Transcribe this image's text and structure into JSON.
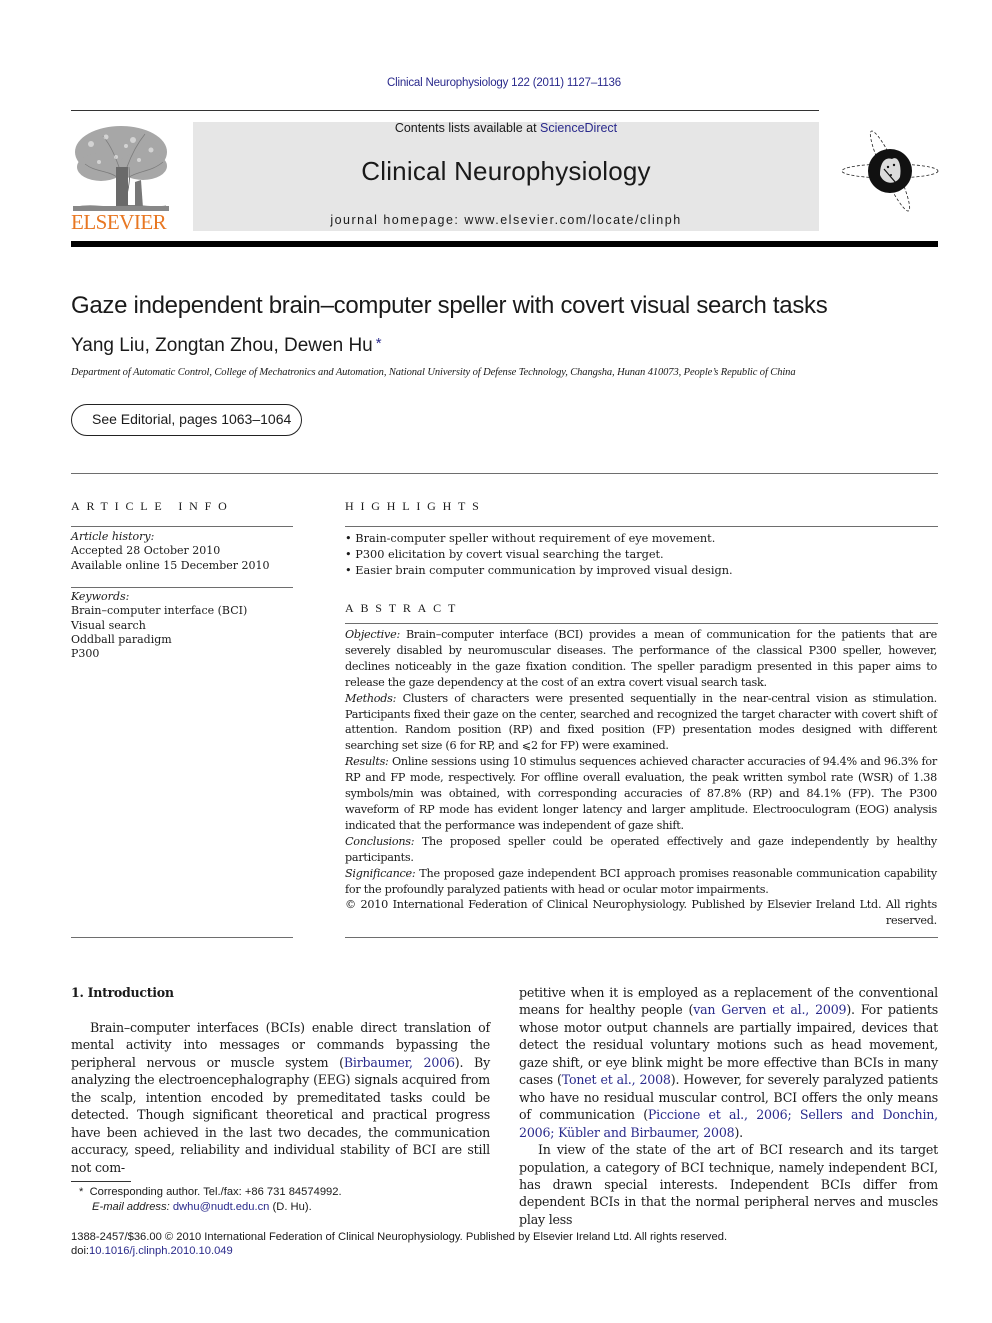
{
  "header": {
    "citation": "Clinical Neurophysiology 122 (2011) 1127–1136",
    "contents_prefix": "Contents lists available at ",
    "contents_link": "ScienceDirect",
    "journal_name": "Clinical Neurophysiology",
    "homepage": "journal homepage: www.elsevier.com/locate/clinph",
    "publisher_logo_text": "ELSEVIER",
    "publisher_logo_icon": "elsevier-tree-icon",
    "society_logo_icon": "society-emblem-icon",
    "colors": {
      "link": "#2a2a8c",
      "elsevier_orange": "#e87722",
      "banner_gray": "#e6e6e6"
    }
  },
  "article": {
    "title": "Gaze independent brain–computer speller with covert visual search tasks",
    "authors": "Yang Liu, Zongtan Zhou, Dewen Hu",
    "corresponding_mark": "*",
    "affiliation": "Department of Automatic Control, College of Mechatronics and Automation, National University of Defense Technology, Changsha, Hunan 410073, People’s Republic of China",
    "editorial_link": "See Editorial, pages 1063–1064"
  },
  "article_info": {
    "heading": "ARTICLE INFO",
    "history_label": "Article history:",
    "history": [
      "Accepted 28 October 2010",
      "Available online 15 December 2010"
    ],
    "keywords_label": "Keywords:",
    "keywords": [
      "Brain–computer interface (BCI)",
      "Visual search",
      "Oddball paradigm",
      "P300"
    ]
  },
  "highlights": {
    "heading": "HIGHLIGHTS",
    "bullet": "•",
    "items": [
      "Brain-computer speller without requirement of eye movement.",
      "P300 elicitation by covert visual searching the target.",
      "Easier brain computer communication by improved visual design."
    ]
  },
  "abstract": {
    "heading": "ABSTRACT",
    "sections": [
      {
        "label": "Objective:",
        "text": " Brain–computer interface (BCI) provides a mean of communication for the patients that are severely disabled by neuromuscular diseases. The performance of the classical P300 speller, however, declines noticeably in the gaze fixation condition. The speller paradigm presented in this paper aims to release the gaze dependency at the cost of an extra covert visual search task."
      },
      {
        "label": "Methods:",
        "text": " Clusters of characters were presented sequentially in the near-central vision as stimulation. Participants fixed their gaze on the center, searched and recognized the target character with covert shift of attention. Random position (RP) and fixed position (FP) presentation modes designed with different searching set size (6 for RP, and ⩽2 for FP) were examined."
      },
      {
        "label": "Results:",
        "text": " Online sessions using 10 stimulus sequences achieved character accuracies of 94.4% and 96.3% for RP and FP mode, respectively. For offline overall evaluation, the peak written symbol rate (WSR) of 1.38 symbols/min was obtained, with corresponding accuracies of 87.8% (RP) and 84.1% (FP). The P300 waveform of RP mode has evident longer latency and larger amplitude. Electrooculogram (EOG) analysis indicated that the performance was independent of gaze shift."
      },
      {
        "label": "Conclusions:",
        "text": " The proposed speller could be operated effectively and gaze independently by healthy participants."
      },
      {
        "label": "Significance:",
        "text": " The proposed gaze independent BCI approach promises reasonable communication capability for the profoundly paralyzed patients with head or ocular motor impairments."
      }
    ],
    "copyright_main": "© 2010 International Federation of Clinical Neurophysiology. Published by Elsevier Ireland Ltd. All rights",
    "copyright_end": "reserved."
  },
  "introduction": {
    "heading": "1. Introduction",
    "left_column": {
      "p1_before": "Brain–computer interfaces (BCIs) enable direct translation of mental activity into messages or commands bypassing the peripheral nervous or muscle system (",
      "p1_link": "Birbaumer, 2006",
      "p1_after": "). By analyzing the electroencephalography (EEG) signals acquired from the scalp, intention encoded by premeditated tasks could be detected. Though significant theoretical and practical progress have been achieved in the last two decades, the communication accuracy, speed, reliability and individual stability of BCI are still not com-"
    },
    "right_column": {
      "p1_a": "petitive when it is employed as a replacement of the conventional means for healthy people (",
      "p1_link1": "van Gerven et al., 2009",
      "p1_b": "). For patients whose motor output channels are partially impaired, devices that detect the residual voluntary motions such as head movement, gaze shift, or eye blink might be more effective than BCIs in many cases (",
      "p1_link2": "Tonet et al., 2008",
      "p1_c": "). However, for severely paralyzed patients who have no residual muscular control, BCI offers the only means of communication (",
      "p1_link3": "Piccione et al., 2006; Sellers and Donchin, 2006; Kübler and Birbaumer, 2008",
      "p1_d": ").",
      "p2": "In view of the state of the art of BCI research and its target population, a category of BCI technique, namely independent BCI, has drawn special interests. Independent BCIs differ from dependent BCIs in that the normal peripheral nerves and muscles play less"
    }
  },
  "footnote": {
    "mark": "*",
    "corresponding": "Corresponding author. Tel./fax: +86 731 84574992.",
    "email_label": "E-mail address:",
    "email": "dwhu@nudt.edu.cn",
    "email_suffix": " (D. Hu)."
  },
  "footer": {
    "issn_line": "1388-2457/$36.00 © 2010 International Federation of Clinical Neurophysiology. Published by Elsevier Ireland Ltd. All rights reserved.",
    "doi_prefix": "doi:",
    "doi": "10.1016/j.clinph.2010.10.049"
  }
}
